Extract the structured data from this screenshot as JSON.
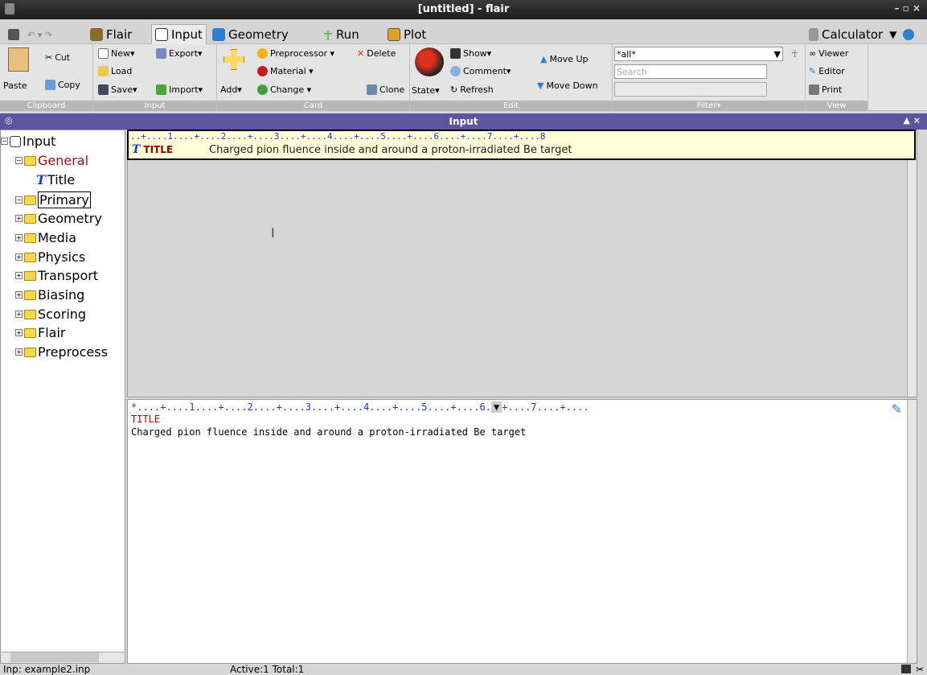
{
  "window": {
    "title": "[untitled] - flair",
    "controls": "– ▫ ×"
  },
  "menubar": {
    "tabs": [
      {
        "label": "Flair",
        "color": "#8a6a2c"
      },
      {
        "label": "Input",
        "color": "#444"
      },
      {
        "label": "Geometry",
        "color": "#2d7fd0"
      },
      {
        "label": "Run",
        "color": "#3aa02b"
      },
      {
        "label": "Plot",
        "color": "#e0a020"
      }
    ],
    "calculator": "Calculator"
  },
  "ribbon": {
    "clipboard": {
      "cut": "Cut",
      "copy": "Copy",
      "paste": "Paste",
      "label": "Clipboard"
    },
    "input": {
      "new": "New▾",
      "load": "Load",
      "save": "Save▾",
      "export": "Export▾",
      "import": "Import▾",
      "label": "Input"
    },
    "card": {
      "add": "Add▾",
      "preprocessor": "Preprocessor ▾",
      "material": "Material ▾",
      "change": "Change ▾",
      "delete": "Delete",
      "clone": "Clone",
      "label": "Card"
    },
    "edit": {
      "state": "State▾",
      "show": "Show▾",
      "comment": "Comment▾",
      "refresh": "Refresh",
      "move_up": "Move Up",
      "move_down": "Move Down",
      "label": "Edit"
    },
    "filter": {
      "value": "*all*",
      "search_placeholder": "Search",
      "label": "Filter▾"
    },
    "view": {
      "viewer": "Viewer",
      "editor": "Editor",
      "print": "Print",
      "label": "View"
    }
  },
  "panel": {
    "title": "Input"
  },
  "tree": {
    "root": "Input",
    "items": [
      "General",
      "Title",
      "Primary",
      "Geometry",
      "Media",
      "Physics",
      "Transport",
      "Biasing",
      "Scoring",
      "Flair",
      "Preprocess"
    ]
  },
  "card": {
    "ruler": "..+....1....+....2....+....3....+....4....+....5....+....6....+....7....+....8",
    "name": "TITLE",
    "text": "Charged pion fluence inside and around a proton-irradiated Be target"
  },
  "editor": {
    "ruler": "*....+....1....+....2....+....3....+....4....+....5....+....6.",
    "ruler_tail": "+....7....+....",
    "line1": "TITLE",
    "line2": "Charged pion fluence inside and around a proton-irradiated Be target"
  },
  "status": {
    "file": "Inp: example2.inp",
    "counts": "Active:1  Total:1"
  }
}
